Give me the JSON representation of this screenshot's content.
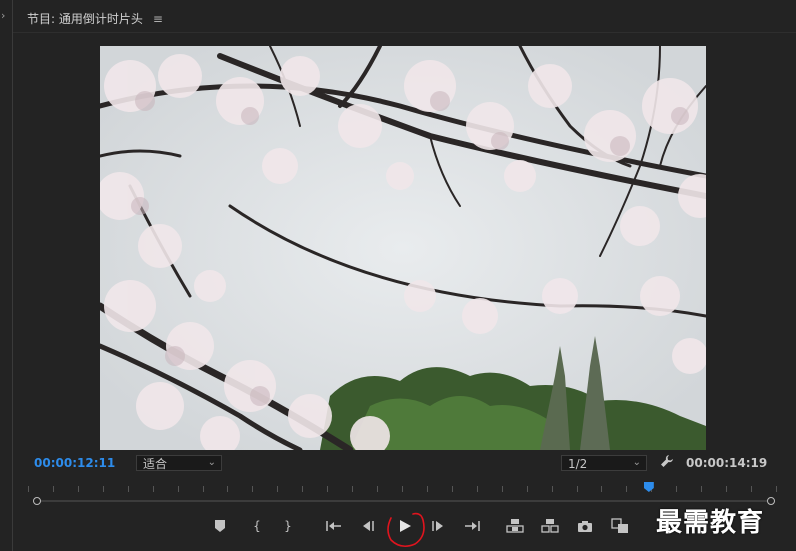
{
  "panel": {
    "title": "节目: 通用倒计时片头",
    "menu_icon": "hamburger-icon"
  },
  "playback": {
    "current_timecode": "00:00:12:11",
    "duration_timecode": "00:00:14:19",
    "zoom_selected": "适合",
    "resolution_selected": "1/2",
    "playhead_fraction": 0.83
  },
  "controls": [
    {
      "name": "add-marker-button",
      "icon": "marker-icon"
    },
    {
      "name": "mark-in-button",
      "icon": "mark-in-icon"
    },
    {
      "name": "mark-out-button",
      "icon": "mark-out-icon"
    },
    {
      "name": "go-to-in-button",
      "icon": "go-to-in-icon"
    },
    {
      "name": "step-back-button",
      "icon": "step-back-icon"
    },
    {
      "name": "play-button",
      "icon": "play-icon"
    },
    {
      "name": "step-forward-button",
      "icon": "step-forward-icon"
    },
    {
      "name": "go-to-out-button",
      "icon": "go-to-out-icon"
    },
    {
      "name": "lift-button",
      "icon": "lift-icon"
    },
    {
      "name": "extract-button",
      "icon": "extract-icon"
    },
    {
      "name": "export-frame-button",
      "icon": "camera-icon"
    },
    {
      "name": "compare-button",
      "icon": "compare-icon"
    }
  ],
  "watermark": {
    "text": "最需教育"
  },
  "colors": {
    "accent": "#2d8ceb",
    "background": "#232323",
    "annotation": "#e0141e"
  }
}
